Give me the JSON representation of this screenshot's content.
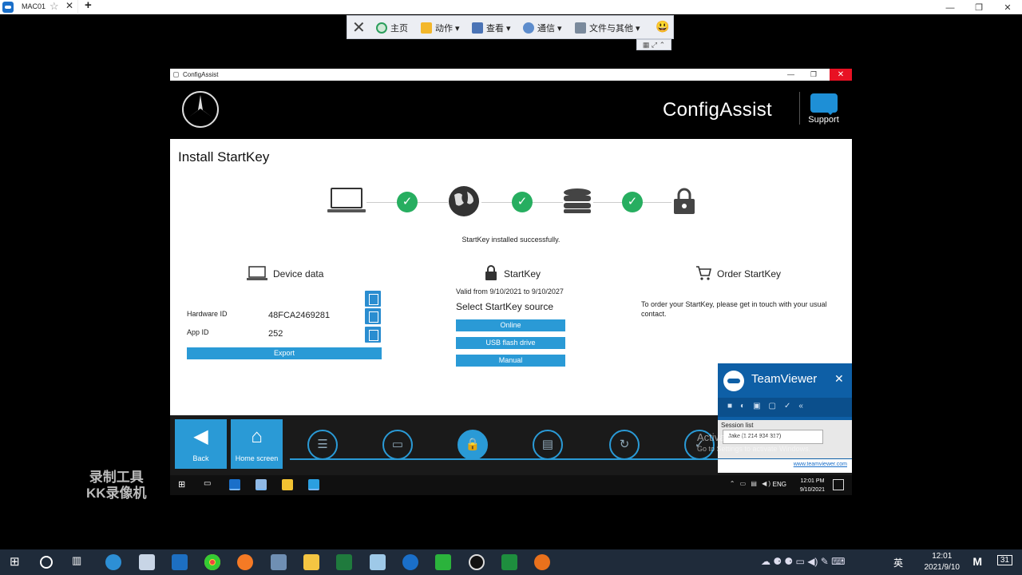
{
  "host": {
    "tab_label": "MAC01",
    "toolbar": {
      "home": "主页",
      "actions": "动作",
      "view": "查看",
      "communicate": "通信",
      "files": "文件与其他"
    }
  },
  "app": {
    "window_title": "ConfigAssist",
    "brand": "ConfigAssist",
    "support_label": "Support",
    "page_title": "Install StartKey",
    "status_message": "StartKey installed successfully.",
    "device": {
      "heading": "Device data",
      "hardware_label": "Hardware ID",
      "hardware_value": "48FCA2469281",
      "app_label": "App ID",
      "app_value": "252",
      "export_label": "Export"
    },
    "startkey": {
      "heading": "StartKey",
      "validity": "Valid from 9/10/2021 to 9/10/2027",
      "source_label": "Select StartKey source",
      "options": [
        "Online",
        "USB flash drive",
        "Manual"
      ]
    },
    "order": {
      "heading": "Order StartKey",
      "text": "To order your StartKey, please get in touch with your usual contact."
    },
    "nav": {
      "back": "Back",
      "home": "Home screen"
    }
  },
  "teamviewer": {
    "title": "TeamViewer",
    "session_header": "Session list",
    "session_entry": "Jake (1 214 934 317)",
    "footer_link": "www.teamviewer.com"
  },
  "activation": {
    "title": "Activate Windows",
    "subtitle": "Go to Settings to activate Windows."
  },
  "remote_taskbar": {
    "time": "12:01 PM",
    "date": "9/10/2021",
    "lang": "ENG"
  },
  "watermark": {
    "line1": "录制工具",
    "line2": "KK录像机"
  },
  "host_taskbar": {
    "time": "12:01",
    "date": "2021/9/10",
    "ime": "英",
    "notifications": "31"
  }
}
